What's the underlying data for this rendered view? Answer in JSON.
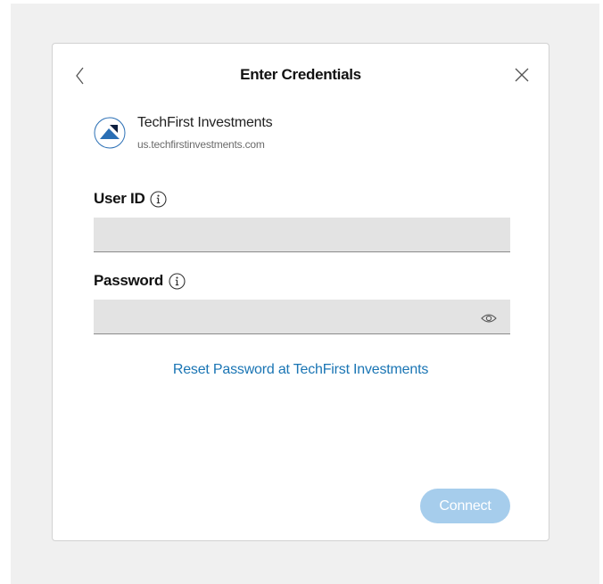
{
  "dialog": {
    "title": "Enter Credentials",
    "back_icon": "chevron-left-icon",
    "close_icon": "close-icon"
  },
  "institution": {
    "name": "TechFirst Investments",
    "url": "us.techfirstinvestments.com",
    "logo_icon": "techfirst-logo"
  },
  "fields": {
    "user_id": {
      "label": "User ID",
      "value": "",
      "info_icon": "info-icon"
    },
    "password": {
      "label": "Password",
      "value": "",
      "info_icon": "info-icon",
      "toggle_icon": "eye-icon"
    }
  },
  "reset_link": "Reset Password at TechFirst Investments",
  "connect_button": {
    "label": "Connect",
    "enabled": false
  },
  "colors": {
    "link": "#1a75b4",
    "button_disabled": "#a6cdec",
    "logo_blue": "#2a6fb5",
    "logo_dark": "#0d1f3f"
  }
}
